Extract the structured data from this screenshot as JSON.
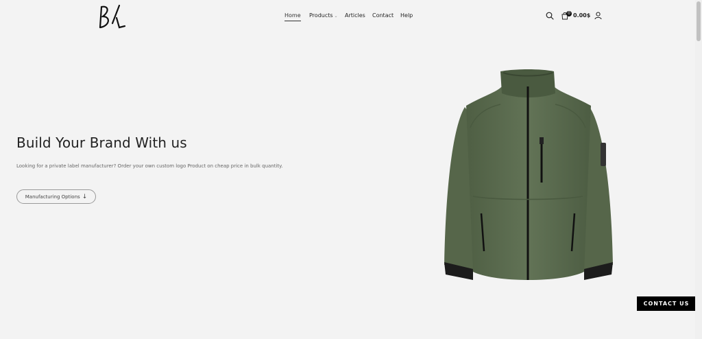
{
  "header": {
    "logo_text": "BL",
    "nav": [
      {
        "label": "Home",
        "active": true
      },
      {
        "label": "Products",
        "has_dropdown": true
      },
      {
        "label": "Articles"
      },
      {
        "label": "Contact"
      },
      {
        "label": "Help"
      }
    ],
    "cart": {
      "count": "0",
      "total": "0.00$"
    },
    "icons": [
      "search-icon",
      "cart-icon",
      "user-icon"
    ]
  },
  "hero": {
    "title": "Build Your Brand With us",
    "subtitle": "Looking for a private label manufacturer? Order your own custom logo Product on cheap price in bulk quantity.",
    "button_label": "Manufacturing Options",
    "product_color": "#5a6b4e"
  },
  "contact_button": "CONTACT US"
}
